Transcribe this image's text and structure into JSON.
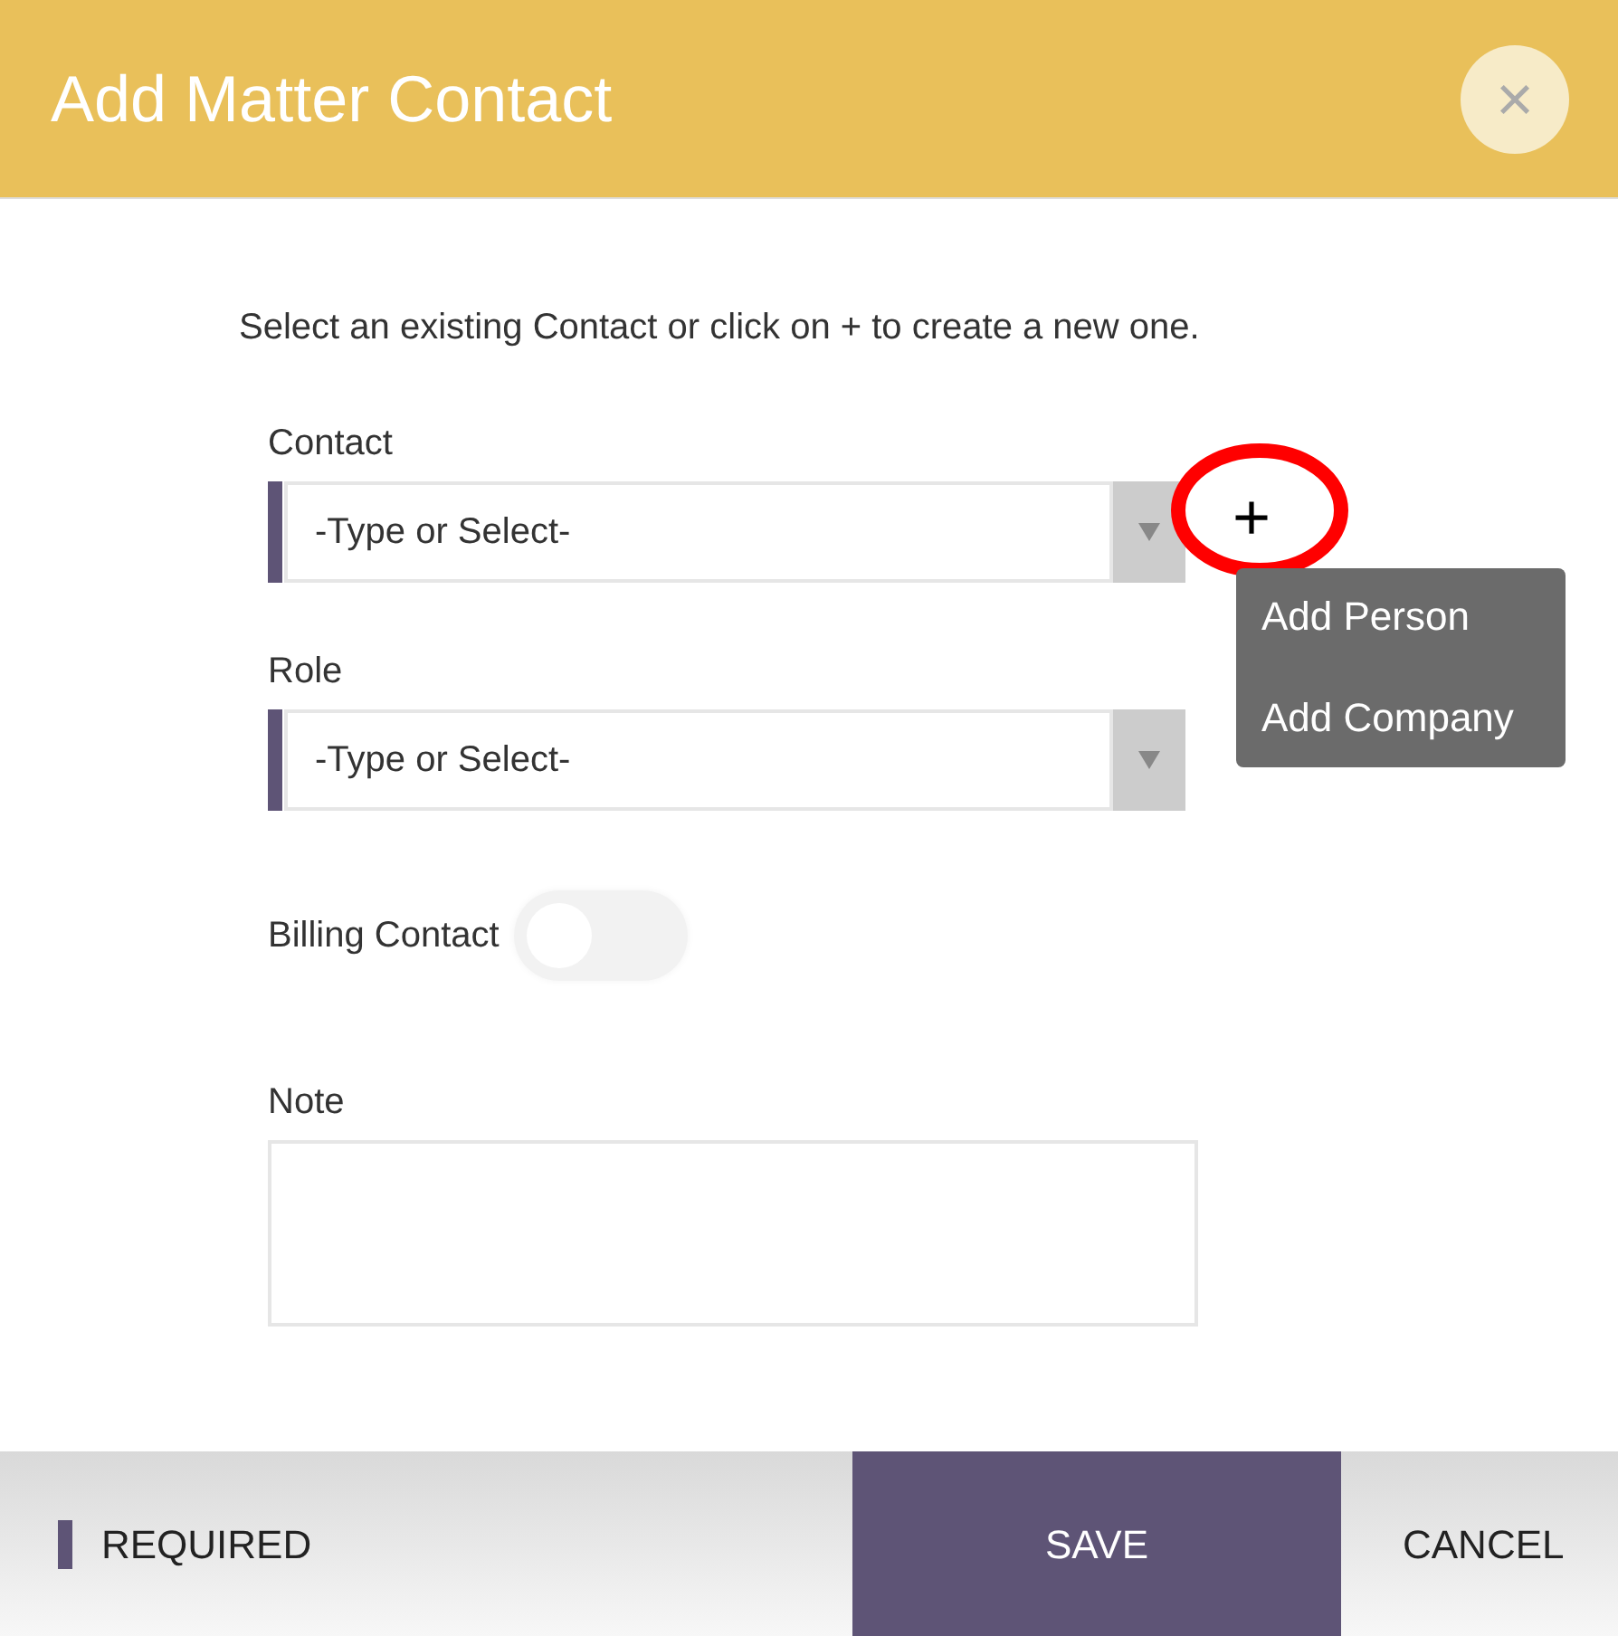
{
  "dialog": {
    "title": "Add Matter Contact",
    "close": "×"
  },
  "instructions": "Select an existing Contact or click on + to create a new one.",
  "fields": [
    {
      "kind": "select",
      "label": "Contact",
      "placeholder": "-Type or Select-",
      "required": true,
      "add_button": "+",
      "menu": [
        "Add Person",
        "Add Company"
      ]
    },
    {
      "kind": "select",
      "label": "Role",
      "placeholder": "-Type or Select-",
      "required": true
    },
    {
      "kind": "toggle",
      "label": "Billing Contact",
      "on": false
    },
    {
      "kind": "textarea",
      "label": "Note"
    }
  ],
  "footer": {
    "legend": "REQUIRED",
    "buttons": [
      {
        "label": "SAVE",
        "primary": true
      },
      {
        "label": "CANCEL",
        "primary": false
      }
    ]
  }
}
